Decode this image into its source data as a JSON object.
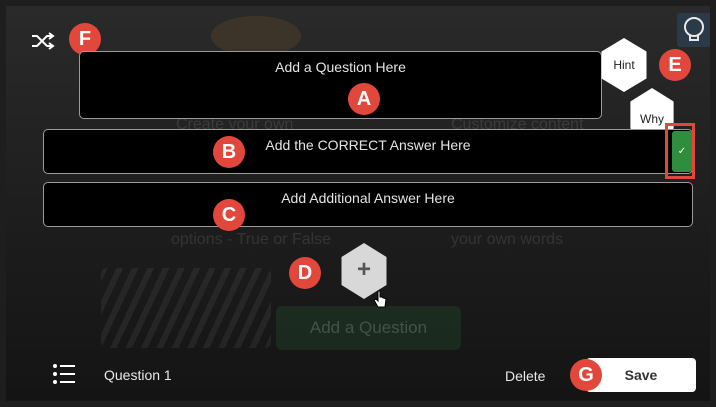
{
  "editor": {
    "question_placeholder": "Add a Question Here",
    "correct_answer_placeholder": "Add the CORRECT Answer Here",
    "additional_answer_placeholder": "Add Additional Answer Here",
    "hint_label": "Hint",
    "why_label": "Why",
    "check_mark": "✓",
    "add_answer_symbol": "+"
  },
  "background": {
    "line1a": "Create your own",
    "line1b": "Customize content",
    "line2a": "options - True or False",
    "line2b": "your own words",
    "add_question_label": "Add a Question"
  },
  "callouts": {
    "a": "A",
    "b": "B",
    "c": "C",
    "d": "D",
    "e": "E",
    "f": "F",
    "g": "G"
  },
  "footer": {
    "question_label": "Question 1",
    "delete_label": "Delete",
    "save_label": "Save"
  },
  "icons": {
    "shuffle": "shuffle-icon",
    "lightbulb": "lightbulb-icon",
    "list": "question-list-icon",
    "cursor": "hand-cursor-icon"
  },
  "colors": {
    "callout": "#e2473c",
    "correct_toggle": "#2f8d3e",
    "highlight": "#e2473c",
    "field_bg": "#000000"
  }
}
